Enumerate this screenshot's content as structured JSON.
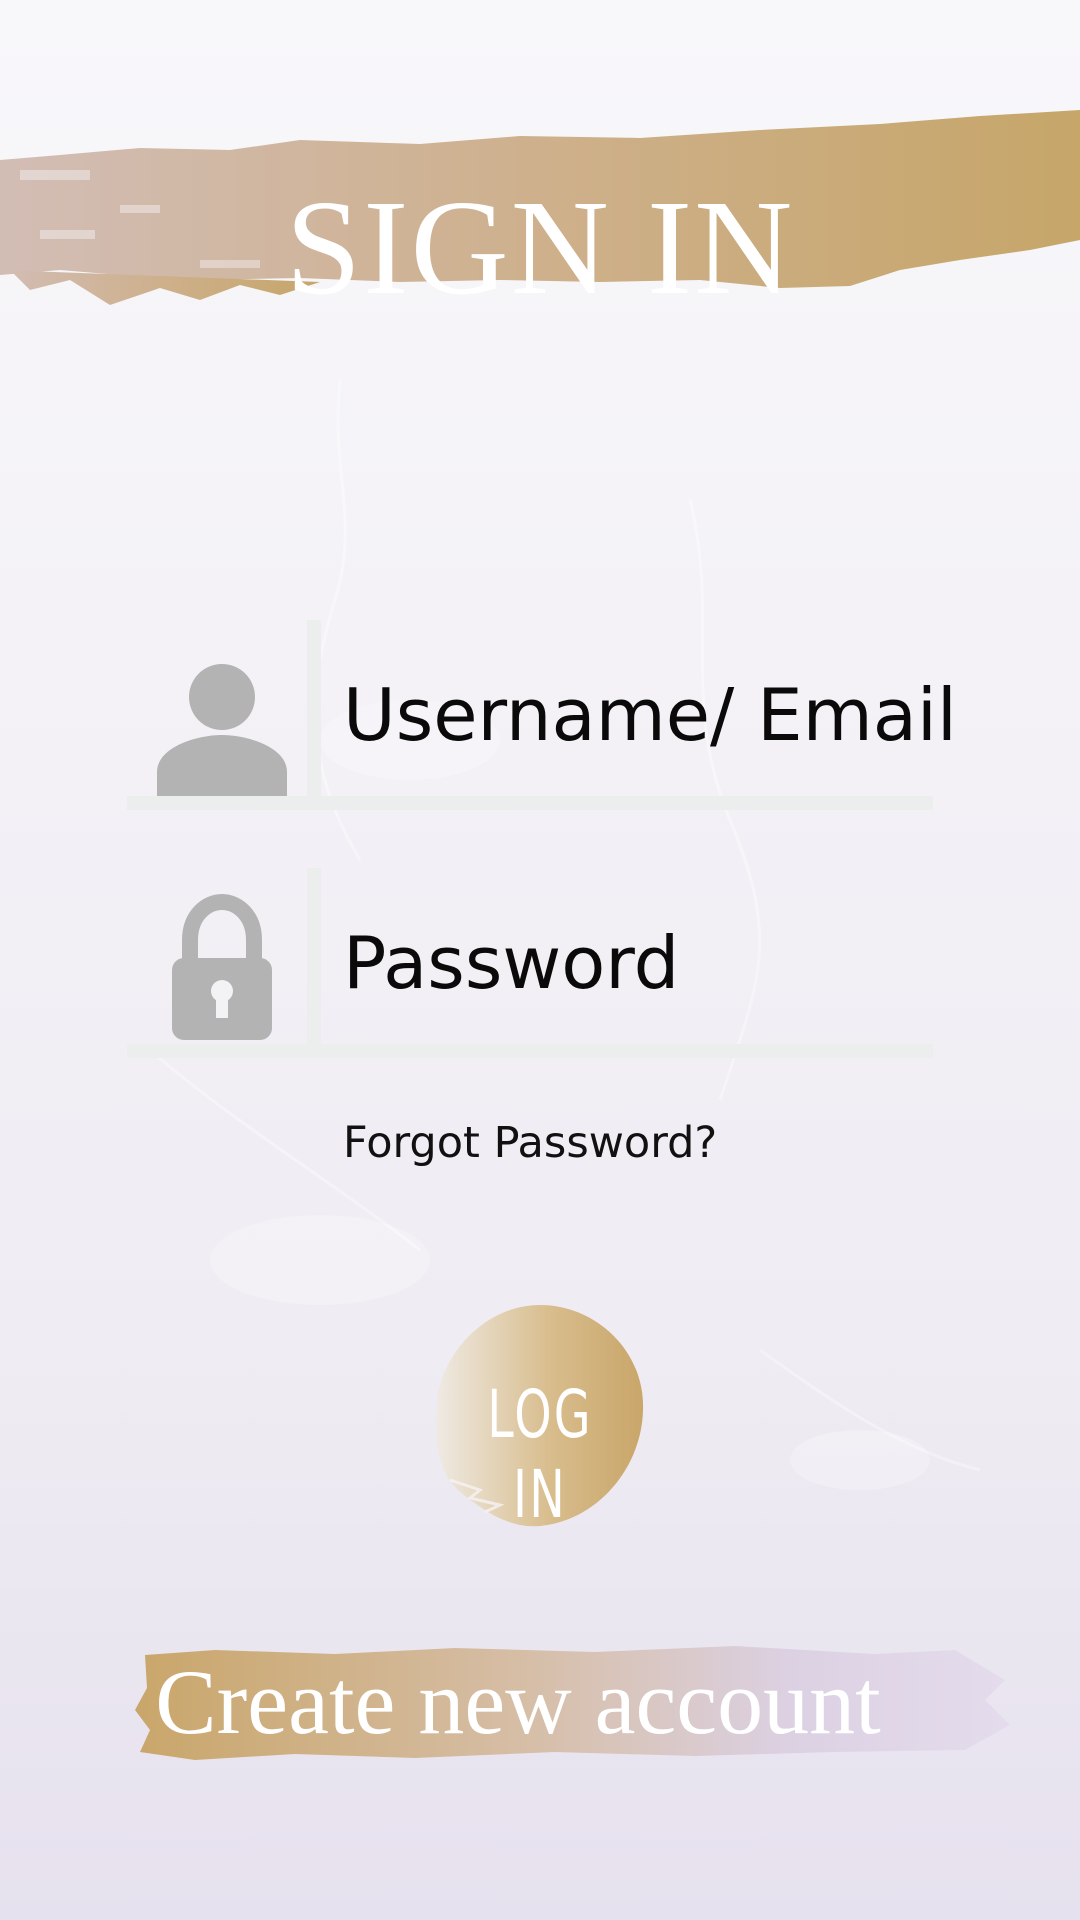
{
  "header": {
    "title": "SIGN IN"
  },
  "form": {
    "username": {
      "label": "Username/ Email",
      "icon": "user-icon"
    },
    "password": {
      "label": "Password",
      "icon": "lock-icon"
    },
    "forgot_password_label": "Forgot Password?"
  },
  "actions": {
    "login_label": "LOG IN",
    "create_account_label": "Create new account"
  },
  "colors": {
    "gold": "#c9a86a",
    "mauve": "#d2bdb5",
    "lavender": "#ddd3e6",
    "icon_gray": "#b3b3b3",
    "field_line": "#eceeee",
    "text": "#0a0a0a"
  }
}
